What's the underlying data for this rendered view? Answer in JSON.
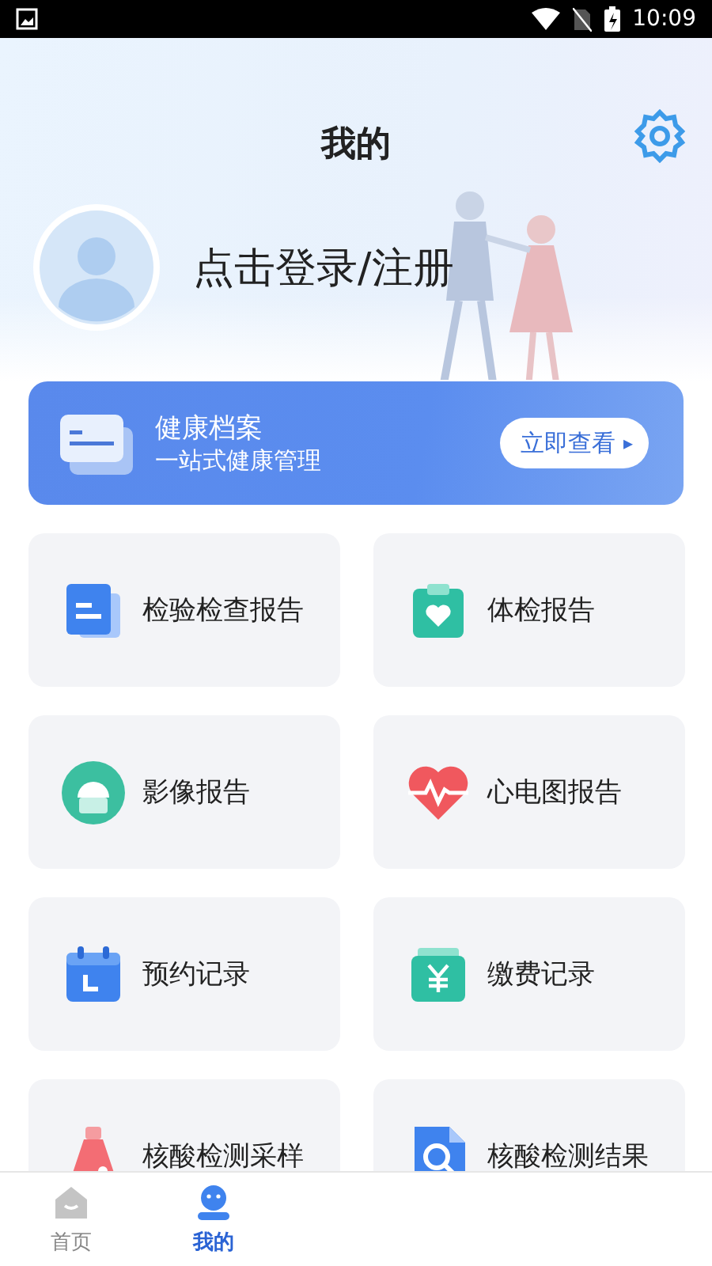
{
  "status_bar": {
    "time": "10:09"
  },
  "header": {
    "title": "我的",
    "login_text": "点击登录/注册"
  },
  "banner": {
    "title": "健康档案",
    "subtitle": "一站式健康管理",
    "button": "立即查看",
    "button_arrow": "▸"
  },
  "services": [
    {
      "kind": "report",
      "label": "检验检查报告"
    },
    {
      "kind": "checkup",
      "label": "体检报告"
    },
    {
      "kind": "imaging",
      "label": "影像报告"
    },
    {
      "kind": "ecg",
      "label": "心电图报告"
    },
    {
      "kind": "appointment",
      "label": "预约记录"
    },
    {
      "kind": "payment",
      "label": "缴费记录"
    },
    {
      "kind": "sample",
      "label": "核酸检测采样"
    },
    {
      "kind": "result",
      "label": "核酸检测结果"
    }
  ],
  "bottom_nav": [
    {
      "kind": "home",
      "label": "首页",
      "selected": false
    },
    {
      "kind": "mine",
      "label": "我的",
      "selected": true
    }
  ]
}
